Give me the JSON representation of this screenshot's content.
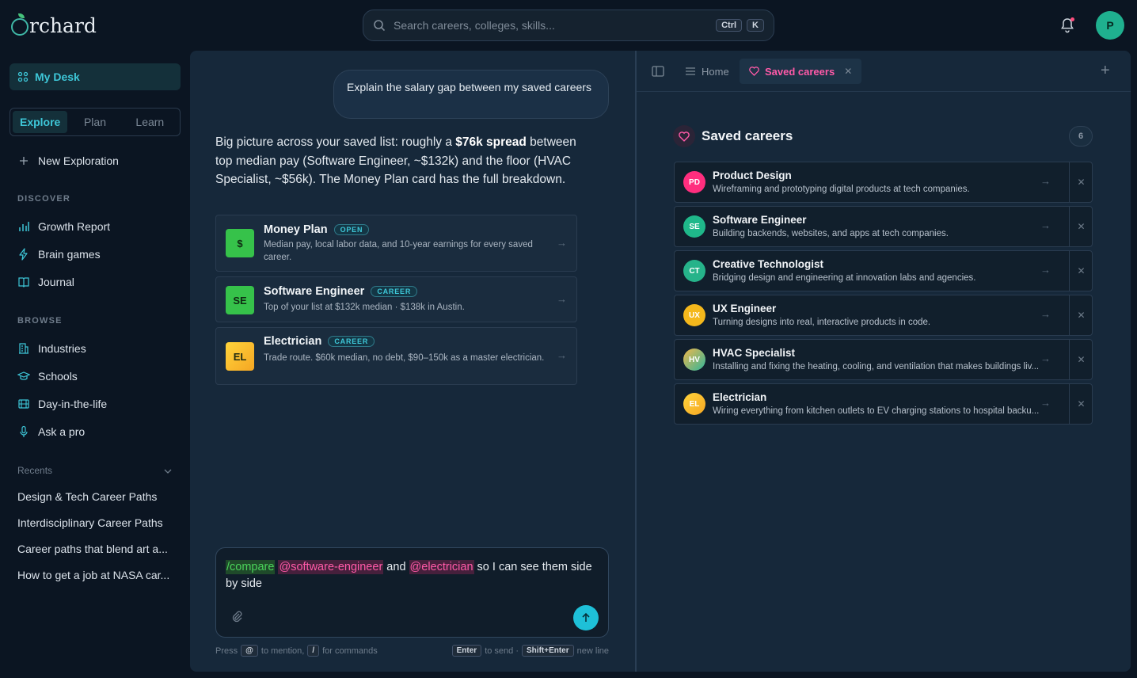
{
  "app": {
    "logo_text": "rchard"
  },
  "search": {
    "placeholder": "Search careers, colleges, skills...",
    "kbd1": "Ctrl",
    "kbd2": "K"
  },
  "user": {
    "initial": "P"
  },
  "sidebar": {
    "my_desk": "My Desk",
    "modes": [
      "Explore",
      "Plan",
      "Learn"
    ],
    "new_exploration": "New Exploration",
    "discover_label": "DISCOVER",
    "discover": [
      "Growth Report",
      "Brain games",
      "Journal"
    ],
    "browse_label": "BROWSE",
    "browse": [
      "Industries",
      "Schools",
      "Day-in-the-life",
      "Ask a pro"
    ],
    "recents_label": "Recents",
    "recents": [
      "Design & Tech Career Paths",
      "Interdisciplinary Career Paths",
      "Career paths that blend art a...",
      "How to get a job at NASA car..."
    ]
  },
  "chat": {
    "user_message": "Explain the salary gap between my saved careers",
    "answer_pre": "Big picture across your saved list: roughly a ",
    "answer_bold": "$76k spread",
    "answer_post": " between top median pay (Software Engineer, ~$132k) and the floor (HVAC Specialist, ~$56k). The Money Plan card has the full breakdown.",
    "cards": [
      {
        "icon": "$",
        "title": "Money Plan",
        "badge": "OPEN",
        "desc": "Median pay, local labor data, and 10-year earnings for every saved career."
      },
      {
        "icon": "SE",
        "title": "Software Engineer",
        "badge": "CAREER",
        "desc": "Top of your list at $132k median · $138k in Austin."
      },
      {
        "icon": "EL",
        "title": "Electrician",
        "badge": "CAREER",
        "desc": "Trade route. $60k median, no debt, $90–150k as a master electrician."
      }
    ]
  },
  "composer": {
    "command": "/compare",
    "mention1": "@software-engineer",
    "word_and": " and ",
    "mention2": "@electrician",
    "rest": "  so I can  see them side by side",
    "hint_press": "Press",
    "hint_at": "@",
    "hint_mention": "to mention,",
    "hint_slash": "/",
    "hint_commands": "for commands",
    "hint_enter": "Enter",
    "hint_send": "to send ·",
    "hint_shift": "Shift+Enter",
    "hint_newline": "new line"
  },
  "tabs": {
    "home": "Home",
    "saved": "Saved careers"
  },
  "saved": {
    "title": "Saved careers",
    "count": "6",
    "items": [
      {
        "initials": "PD",
        "title": "Product Design",
        "desc": "Wireframing and prototyping digital products at tech companies."
      },
      {
        "initials": "SE",
        "title": "Software Engineer",
        "desc": "Building backends, websites, and apps at tech companies."
      },
      {
        "initials": "CT",
        "title": "Creative Technologist",
        "desc": "Bridging design and engineering at innovation labs and agencies."
      },
      {
        "initials": "UX",
        "title": "UX Engineer",
        "desc": "Turning designs into real, interactive products in code."
      },
      {
        "initials": "HV",
        "title": "HVAC Specialist",
        "desc": "Installing and fixing the heating, cooling, and ventilation that makes buildings liv..."
      },
      {
        "initials": "EL",
        "title": "Electrician",
        "desc": "Wiring everything from kitchen outlets to EV charging stations to hospital backu..."
      }
    ]
  },
  "colors": {
    "accent": "#3ec7d8",
    "pink": "#ff5aa8",
    "green": "#4ad35a",
    "background": "#0b1522",
    "panel": "#16283a"
  }
}
